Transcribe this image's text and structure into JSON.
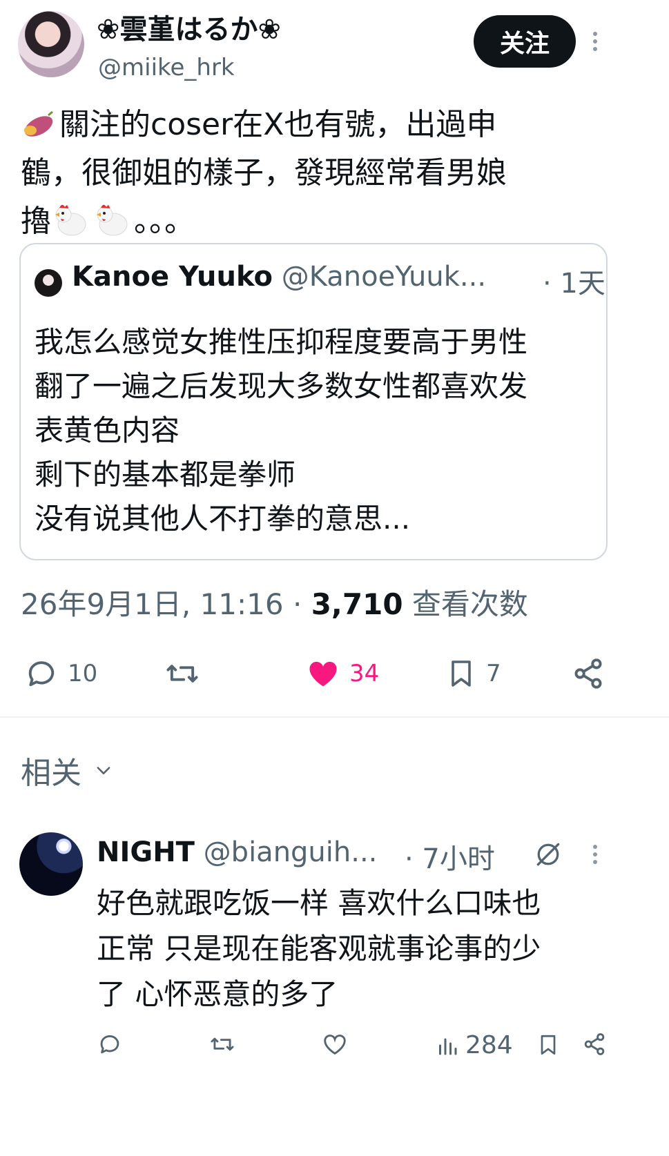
{
  "post": {
    "author_name": "❀雲堇はるか❀",
    "author_handle": "@miike_hrk",
    "follow_label": "关注",
    "lines": [
      "關注的coser在X也有號，出過申",
      "鶴，很御姐的樣子，發現經常看男娘",
      "。。。"
    ],
    "line3_prefix": "擼",
    "timestamp": "26年9月1日, 11:16",
    "views_count": "3,710",
    "views_label": "查看次数"
  },
  "quote": {
    "name": "Kanoe Yuuko",
    "handle": "@KanoeYuuk...",
    "time": "· 1天",
    "lines": [
      "我怎么感觉女推性压抑程度要高于男性",
      "翻了一遍之后发现大多数女性都喜欢发",
      "表黄色内容",
      "剩下的基本都是拳师",
      "没有说其他人不打拳的意思..."
    ]
  },
  "actions": {
    "replies": "10",
    "likes": "34",
    "bookmarks": "7"
  },
  "related": {
    "label": "相关"
  },
  "reply": {
    "name": "NIGHT",
    "handle": "@bianguih...",
    "time": "· 7小时",
    "lines": [
      "好色就跟吃饭一样 喜欢什么口味也",
      "正常 只是现在能客观就事论事的少",
      "了 心怀恶意的多了"
    ],
    "views": "284"
  },
  "icons": {
    "reply": "comment-icon",
    "retweet": "retweet-icon",
    "like": "heart-icon",
    "bookmark": "bookmark-icon",
    "share": "share-icon",
    "views": "views-icon",
    "grok": "grok-icon"
  },
  "colors": {
    "like_pink": "#f91880",
    "muted": "#536471",
    "text": "#0f1419"
  }
}
